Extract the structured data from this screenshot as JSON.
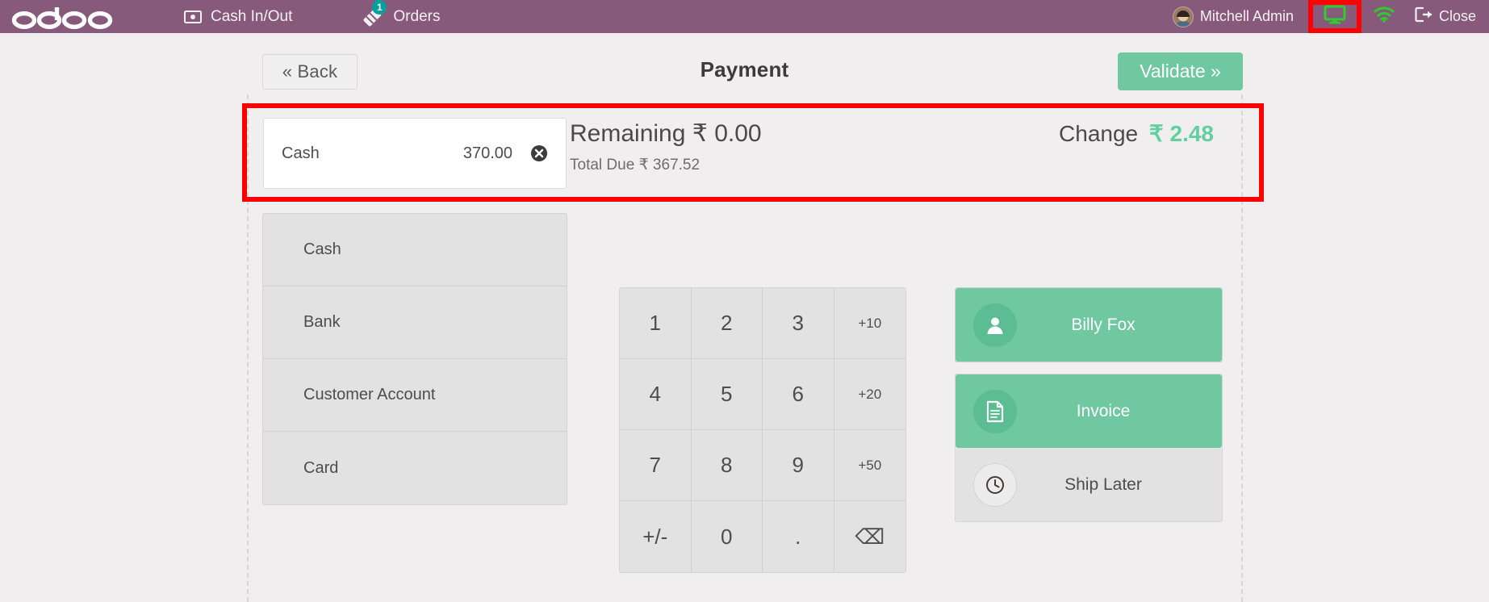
{
  "colors": {
    "brand_purple": "#875A7B",
    "accent_green": "#6FC8A0",
    "change_green": "#61cfa0",
    "badge_teal": "#00a09d",
    "highlight_red": "#ff0000",
    "panel_grey": "#e2e2e2",
    "page_background": "#f0eeee"
  },
  "topbar": {
    "logo_text": "odoo",
    "cash_in_out": {
      "label": "Cash In/Out",
      "icon": "banknote-icon"
    },
    "orders": {
      "label": "Orders",
      "icon": "ticket-icon",
      "badge_count": "1"
    },
    "user_name": "Mitchell Admin",
    "avatar_icon": "user-avatar",
    "display_icon": "display-monitor-icon",
    "wifi_icon": "wifi-icon",
    "close": {
      "label": "Close",
      "icon": "sign-out-icon"
    }
  },
  "subheader": {
    "back_label": "« Back",
    "title": "Payment",
    "validate_label": "Validate »"
  },
  "payment_lines": [
    {
      "name": "Cash",
      "amount": "370.00",
      "delete_icon": "remove-circle-icon"
    }
  ],
  "totals": {
    "remaining_label": "Remaining",
    "remaining_value": "₹ 0.00",
    "total_due_label": "Total Due",
    "total_due_value": "₹ 367.52",
    "change_label": "Change",
    "change_value": "₹ 2.48"
  },
  "payment_methods": [
    {
      "label": "Cash"
    },
    {
      "label": "Bank"
    },
    {
      "label": "Customer Account"
    },
    {
      "label": "Card"
    }
  ],
  "numpad": [
    {
      "label": "1",
      "kind": "digit"
    },
    {
      "label": "2",
      "kind": "digit"
    },
    {
      "label": "3",
      "kind": "digit"
    },
    {
      "label": "+10",
      "kind": "preset"
    },
    {
      "label": "4",
      "kind": "digit"
    },
    {
      "label": "5",
      "kind": "digit"
    },
    {
      "label": "6",
      "kind": "digit"
    },
    {
      "label": "+20",
      "kind": "preset"
    },
    {
      "label": "7",
      "kind": "digit"
    },
    {
      "label": "8",
      "kind": "digit"
    },
    {
      "label": "9",
      "kind": "digit"
    },
    {
      "label": "+50",
      "kind": "preset"
    },
    {
      "label": "+/-",
      "kind": "sign"
    },
    {
      "label": "0",
      "kind": "digit"
    },
    {
      "label": ".",
      "kind": "decimal"
    },
    {
      "label": "⌫",
      "kind": "backspace"
    }
  ],
  "actions": {
    "customer": {
      "label": "Billy Fox",
      "icon": "person-icon",
      "state": "active"
    },
    "invoice": {
      "label": "Invoice",
      "icon": "document-icon",
      "state": "active"
    },
    "ship_later": {
      "label": "Ship Later",
      "icon": "clock-icon",
      "state": "inactive"
    }
  },
  "highlights": [
    {
      "name": "display-icon-highlight"
    },
    {
      "name": "payment-summary-highlight"
    }
  ]
}
